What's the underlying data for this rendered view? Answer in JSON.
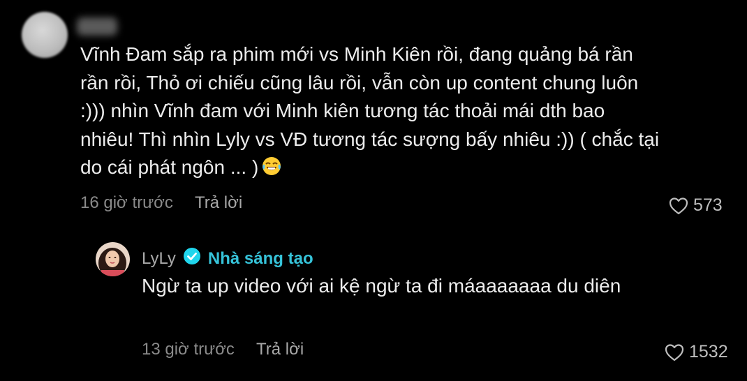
{
  "comment": {
    "text": "Vĩnh Đam sắp ra phim mới vs Minh Kiên rồi, đang quảng bá rần rần rồi, Thỏ ơi chiếu cũng lâu rồi, vẫn còn up content chung luôn :))) nhìn Vĩnh đam với Minh kiên tương tác thoải mái dth bao nhiêu! Thì nhìn Lyly vs VĐ tương tác sượng bấy nhiêu :)) ( chắc tại do cái phát ngôn ... )",
    "time": "16 giờ trước",
    "reply_label": "Trả lời",
    "likes": "573",
    "emoji_icon": "tears-of-joy-emoji"
  },
  "reply": {
    "author": "LyLy",
    "verified_icon": "verified-badge-icon",
    "creator_label": "Nhà sáng tạo",
    "text": "Ngừ ta up video với ai kệ ngừ ta đi máaaaaaaa du diên",
    "time": "13 giờ trước",
    "reply_label": "Trả lời",
    "likes": "1532"
  },
  "colors": {
    "background": "#000000",
    "text": "#ececec",
    "muted": "#8a8a8a",
    "creator_accent": "#36c3d9"
  }
}
